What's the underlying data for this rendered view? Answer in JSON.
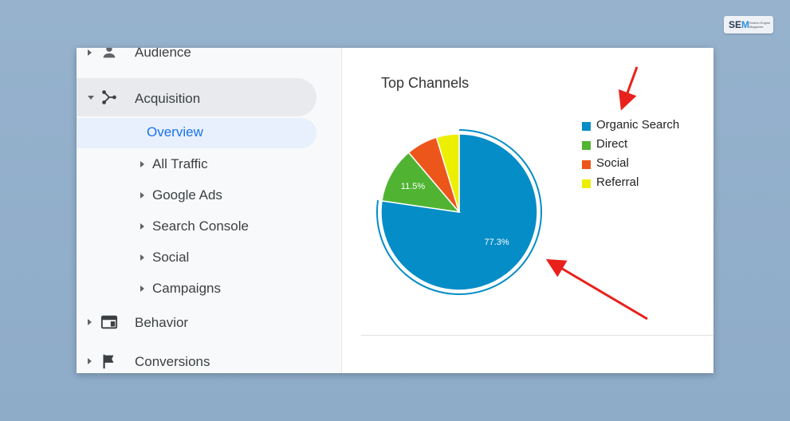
{
  "brand": {
    "logo_main": "SE",
    "logo_accent": "M",
    "tagline": "Search Engine Magazine"
  },
  "sidebar": {
    "top_items": [
      {
        "label": "Audience",
        "icon": "person-icon",
        "state": "collapsed"
      },
      {
        "label": "Acquisition",
        "icon": "acquisition-icon",
        "state": "expanded"
      },
      {
        "label": "Behavior",
        "icon": "behavior-icon",
        "state": "collapsed"
      },
      {
        "label": "Conversions",
        "icon": "flag-icon",
        "state": "collapsed"
      }
    ],
    "active_sub": "Overview",
    "sub_items": [
      "All Traffic",
      "Google Ads",
      "Search Console",
      "Social",
      "Campaigns"
    ]
  },
  "content": {
    "title": "Top Channels"
  },
  "chart_data": {
    "type": "pie",
    "title": "Top Channels",
    "slices": [
      {
        "label": "Organic Search",
        "value": 77.3,
        "color": "#058dc7"
      },
      {
        "label": "Direct",
        "value": 11.5,
        "color": "#50b432"
      },
      {
        "label": "Social",
        "value": 6.5,
        "color": "#ed561b"
      },
      {
        "label": "Referral",
        "value": 4.7,
        "color": "#edef00"
      }
    ],
    "data_labels": [
      "77.3%",
      "11.5%"
    ],
    "legend_position": "right",
    "highlighted_slice": "Organic Search"
  },
  "annotations": {
    "arrow_color": "#e8211c"
  }
}
